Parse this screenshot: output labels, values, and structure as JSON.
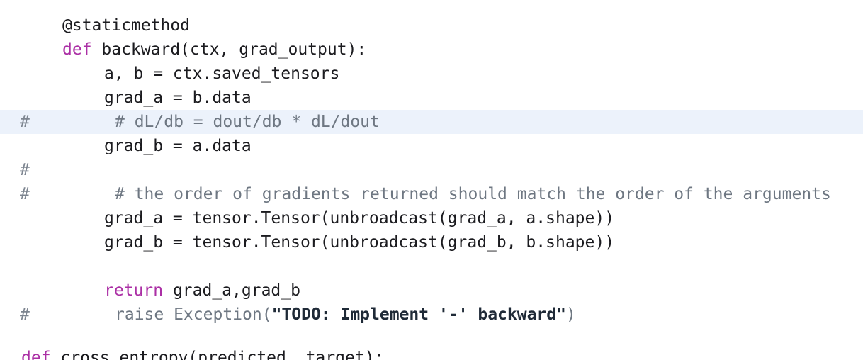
{
  "lines": [
    {
      "code": "@staticmethod"
    },
    {
      "kw": "def",
      "code": " backward(ctx, grad_output):"
    },
    {
      "code": "a, b = ctx.saved_tensors"
    },
    {
      "code": "grad_a = b.data"
    },
    {
      "hash": "#",
      "comment": "# dL/db = dout/db * dL/dout"
    },
    {
      "code": "grad_b = a.data"
    },
    {
      "hash": "#"
    },
    {
      "hash": "#",
      "comment": "# the order of gradients returned should match the order of the arguments"
    },
    {
      "code": "grad_a = tensor.Tensor(unbroadcast(grad_a, a.shape))"
    },
    {
      "code": "grad_b = tensor.Tensor(unbroadcast(grad_b, b.shape))"
    },
    {
      "kw": "return",
      "code": " grad_a,grad_b"
    },
    {
      "hash": "#",
      "comment_pre": "raise Exception(",
      "comment_str": "\"TODO: Implement '-' backward\"",
      "comment_post": ")"
    },
    {
      "kw": "def",
      "code": " cross_entropy(predicted, target):"
    }
  ]
}
